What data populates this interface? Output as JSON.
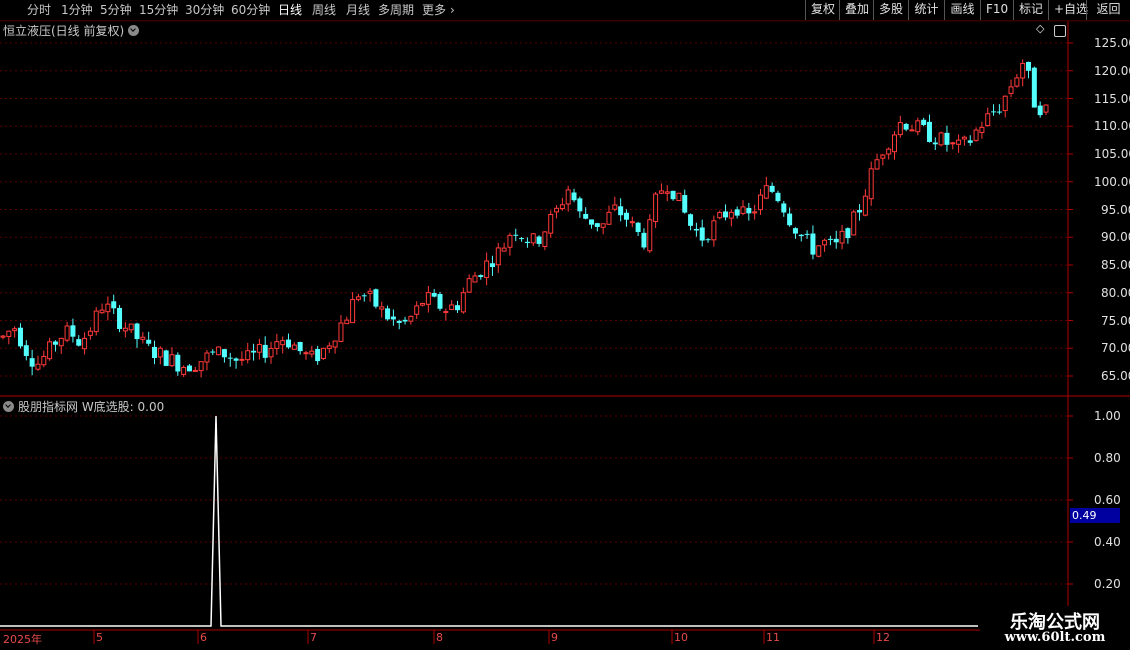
{
  "toolbar": {
    "periods": [
      "分时",
      "1分钟",
      "5分钟",
      "15分钟",
      "30分钟",
      "60分钟",
      "日线",
      "周线",
      "月线",
      "多周期",
      "更多"
    ],
    "active_period": "日线",
    "more_arrow": "chevron-right-icon",
    "actions": [
      "复权",
      "叠加",
      "多股",
      "统计",
      "画线",
      "F10",
      "标记",
      "+自选",
      "返回"
    ]
  },
  "main_panel": {
    "title": "恒立液压(日线 前复权)",
    "price_ticks": [
      "125.00",
      "120.00",
      "115.00",
      "110.00",
      "105.00",
      "100.00",
      "95.00",
      "90.00",
      "85.00",
      "80.00",
      "75.00",
      "70.00",
      "65.00"
    ]
  },
  "indicator_panel": {
    "title": "股朋指标网  W底选股: 0.00",
    "ticks": [
      "1.00",
      "0.80",
      "0.60",
      "0.40",
      "0.20"
    ],
    "cursor_value": "0.49"
  },
  "date_axis": [
    "2025年",
    "5",
    "6",
    "7",
    "8",
    "9",
    "10",
    "11",
    "12"
  ],
  "watermark": {
    "title": "乐淘公式网",
    "url": "www.60lt.com"
  },
  "colors": {
    "up": "#ff3a3a",
    "down": "#54ffff",
    "grid": "#5a0000",
    "axis_border": "#b00000",
    "signal": "#ffffff"
  },
  "chart_data": [
    {
      "type": "candlestick",
      "title": "恒立液压(日线 前复权)",
      "ylim": [
        62,
        127
      ],
      "y_ticks": [
        65,
        70,
        75,
        80,
        85,
        90,
        95,
        100,
        105,
        110,
        115,
        120,
        125
      ],
      "x_months": [
        "2025年",
        "5",
        "6",
        "7",
        "8",
        "9",
        "10",
        "11",
        "12"
      ],
      "close_trend": [
        72,
        74,
        70,
        67,
        69,
        72,
        73,
        71,
        74,
        78,
        76,
        74,
        72,
        70,
        69,
        68,
        67,
        67,
        68,
        69,
        69,
        68,
        68,
        69,
        70,
        72,
        71,
        69,
        68,
        70,
        73,
        76,
        80,
        79,
        77,
        75,
        74,
        76,
        79,
        78,
        77,
        78,
        82,
        84,
        86,
        88,
        92,
        90,
        89,
        92,
        95,
        99,
        94,
        93,
        92,
        95,
        94,
        91,
        89,
        98,
        100,
        96,
        92,
        90,
        92,
        94,
        96,
        93,
        96,
        99,
        97,
        93,
        90,
        88,
        89,
        88,
        91,
        94,
        100,
        105,
        108,
        111,
        110,
        109,
        108,
        107,
        106,
        107,
        110,
        112,
        114,
        118,
        122,
        114,
        113
      ]
    },
    {
      "type": "line",
      "series": [
        {
          "name": "W底选股",
          "signal_spike_month": "6",
          "spike_value": 1.0
        }
      ],
      "ylim": [
        0,
        1.05
      ],
      "y_ticks": [
        1.0,
        0.8,
        0.6,
        0.4,
        0.2
      ],
      "current_value": 0.0
    }
  ]
}
